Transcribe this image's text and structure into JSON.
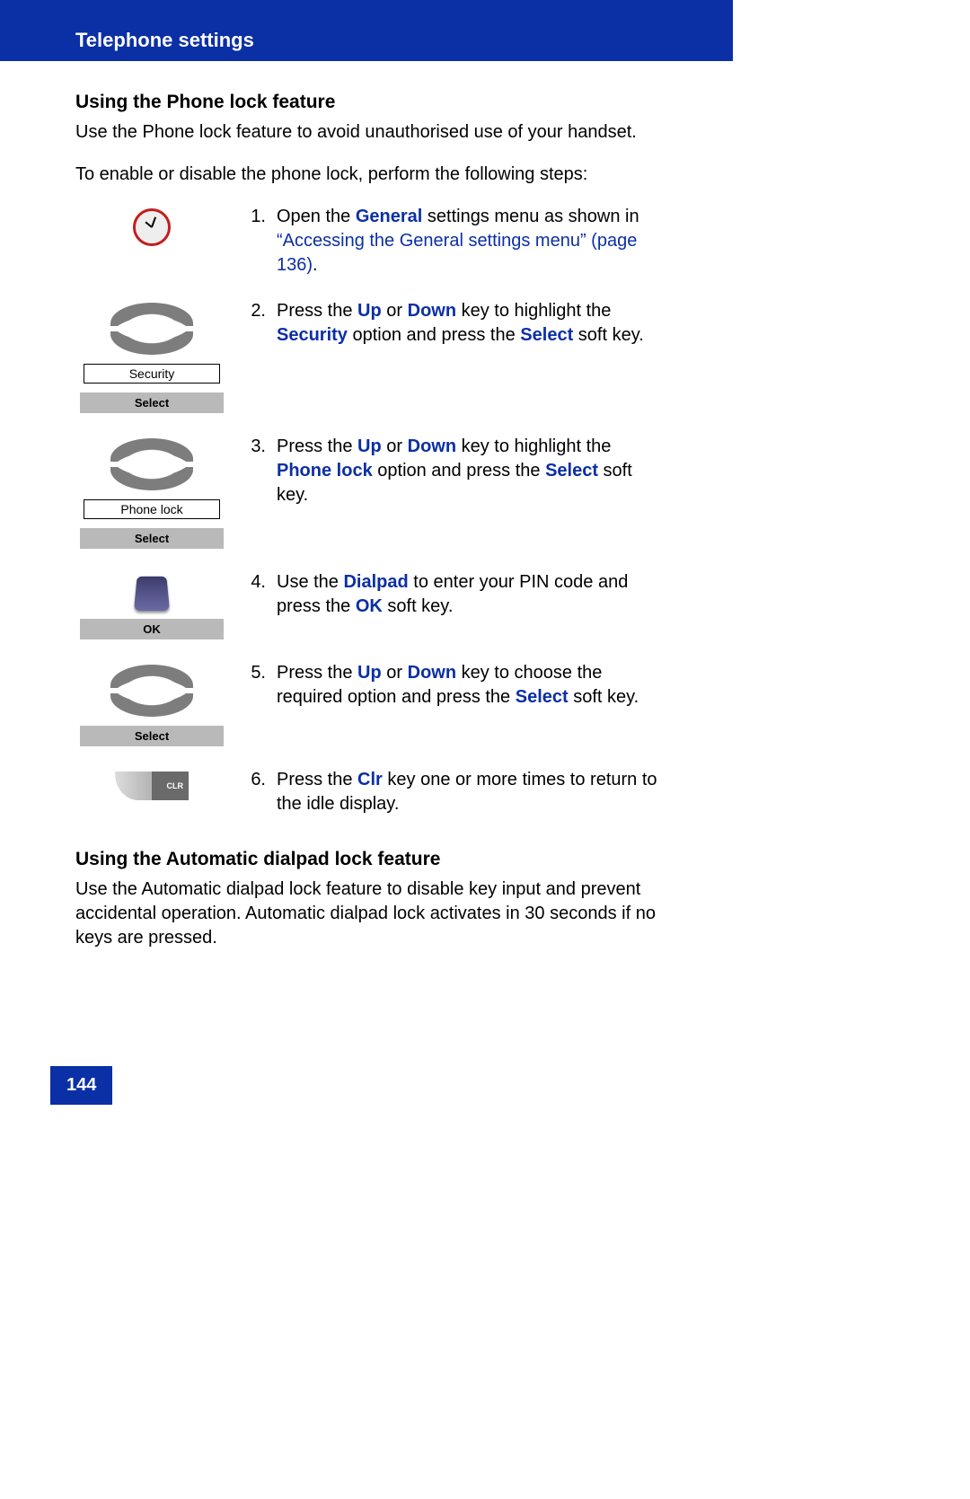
{
  "header": {
    "title": "Telephone settings"
  },
  "page_number": "144",
  "section1": {
    "title": "Using the Phone lock feature",
    "intro": "Use the Phone lock feature to avoid unauthorised use of your handset.",
    "lead": "To enable or disable the phone lock, perform the following steps:"
  },
  "steps": [
    {
      "num": "1.",
      "parts": [
        {
          "t": "Open the "
        },
        {
          "t": "General",
          "cls": "em-blue"
        },
        {
          "t": " settings menu as shown in "
        },
        {
          "t": "“Accessing the General settings menu” (page 136)",
          "cls": "link-blue"
        },
        {
          "t": "."
        }
      ],
      "icon": "gear"
    },
    {
      "num": "2.",
      "parts": [
        {
          "t": "Press the "
        },
        {
          "t": "Up",
          "cls": "em-blue"
        },
        {
          "t": " or "
        },
        {
          "t": "Down",
          "cls": "em-blue"
        },
        {
          "t": " key to highlight the "
        },
        {
          "t": "Security",
          "cls": "em-blue"
        },
        {
          "t": " option and press the "
        },
        {
          "t": "Select",
          "cls": "em-blue"
        },
        {
          "t": " soft key."
        }
      ],
      "icon": "rocker",
      "menu_label": "Security",
      "softkey": "Select"
    },
    {
      "num": "3.",
      "parts": [
        {
          "t": "Press the "
        },
        {
          "t": "Up",
          "cls": "em-blue"
        },
        {
          "t": " or "
        },
        {
          "t": "Down",
          "cls": "em-blue"
        },
        {
          "t": " key to highlight the "
        },
        {
          "t": "Phone lock",
          "cls": "em-blue"
        },
        {
          "t": " option and press the "
        },
        {
          "t": "Select",
          "cls": "em-blue"
        },
        {
          "t": " soft key."
        }
      ],
      "icon": "rocker",
      "menu_label": "Phone lock",
      "softkey": "Select"
    },
    {
      "num": "4.",
      "parts": [
        {
          "t": "Use the "
        },
        {
          "t": "Dialpad",
          "cls": "em-blue"
        },
        {
          "t": " to enter your PIN code and press the "
        },
        {
          "t": "OK",
          "cls": "em-blue"
        },
        {
          "t": " soft key."
        }
      ],
      "icon": "phone",
      "softkey": "OK"
    },
    {
      "num": "5.",
      "parts": [
        {
          "t": "Press the "
        },
        {
          "t": "Up",
          "cls": "em-blue"
        },
        {
          "t": " or "
        },
        {
          "t": "Down",
          "cls": "em-blue"
        },
        {
          "t": " key to choose the required option and press the "
        },
        {
          "t": "Select",
          "cls": "em-blue"
        },
        {
          "t": " soft key."
        }
      ],
      "icon": "rocker",
      "softkey": "Select"
    },
    {
      "num": "6.",
      "parts": [
        {
          "t": "Press the "
        },
        {
          "t": "Clr",
          "cls": "em-blue"
        },
        {
          "t": " key one or more times to return to the idle display."
        }
      ],
      "icon": "clr",
      "clr_label": "CLR"
    }
  ],
  "section2": {
    "title": "Using the Automatic dialpad lock feature",
    "intro": "Use the Automatic dialpad lock feature to disable key input and prevent accidental operation. Automatic dialpad lock activates in 30 seconds if no keys are pressed."
  }
}
